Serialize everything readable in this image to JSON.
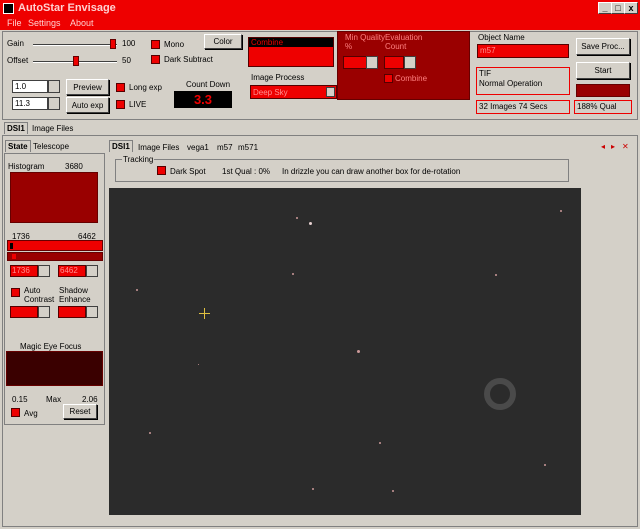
{
  "window": {
    "title": "AutoStar Envisage",
    "minimize_glyph": "_",
    "maximize_glyph": "□",
    "close_glyph": "x"
  },
  "menu": [
    "File",
    "Settings",
    "About"
  ],
  "controls": {
    "gain_label": "Gain",
    "gain_value": "100",
    "offset_label": "Offset",
    "offset_value": "50",
    "mono_label": "Mono",
    "dark_subtract_label": "Dark Subtract",
    "color_button": "Color",
    "exposure_value": "1.0",
    "second_value": "11.3",
    "preview_button": "Preview",
    "auto_exp_button": "Auto exp",
    "long_exp_label": "Long exp",
    "live_label": "LIVE",
    "countdown_label": "Count Down",
    "countdown_value": "3.3",
    "combine_value": "Combine",
    "image_process_label": "Image Process",
    "image_process_value": "Deep Sky",
    "min_quality_label": "Min Quality %",
    "evaluation_count_label": "Evaluation Count",
    "combine_checkbox_label": "Combine",
    "object_name_label": "Object Name",
    "object_name_value": "m57",
    "save_proc_button": "Save Proc...",
    "format_label": "TIF",
    "status_text": "Normal Operation",
    "start_button": "Start",
    "images_status": "32 Images 74 Secs",
    "quality_status": "188% Qual"
  },
  "outer_tabs": [
    "DSI1",
    "Image Files"
  ],
  "left_tabs": [
    "State",
    "Telescope"
  ],
  "left_panel": {
    "histogram_label": "Histogram",
    "histogram_value": "3680",
    "range_low": "1736",
    "range_high": "6462",
    "range_low_input": "1736",
    "range_high_input": "6462",
    "auto_contrast_label": "Auto Contrast",
    "shadow_enhance_label": "Shadow Enhance",
    "magic_eye_label": "Magic Eye Focus",
    "min_value": "0.15",
    "max_label": "Max",
    "max_value": "2.06",
    "avg_label": "Avg",
    "reset_button": "Reset"
  },
  "image_tabs": [
    "DSI1",
    "Image Files",
    "vega1",
    "m57",
    "m571"
  ],
  "tab_nav": {
    "prev": "◂",
    "next": "▸",
    "close": "✕"
  },
  "tracking": {
    "group_label": "Tracking",
    "dark_spot_label": "Dark Spot",
    "first_qual": "1st Qual : 0%",
    "hint": "In drizzle you can draw another box for de-rotation"
  },
  "colors": {
    "accent_red": "#ee0000",
    "dark_red": "#990000",
    "canvas": "#2b2b2b",
    "crosshair": "#e0c040"
  }
}
